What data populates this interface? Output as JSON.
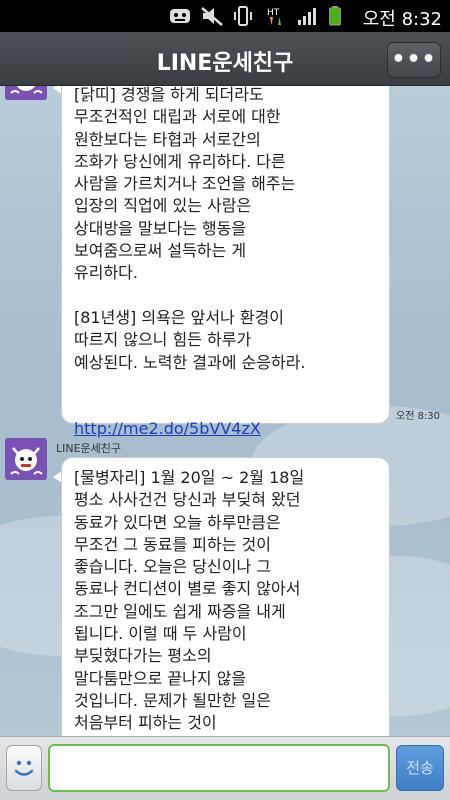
{
  "status_bar": {
    "time": "오전 8:32",
    "icons": [
      "gamepad-notification-icon",
      "mute-icon",
      "vibrate-icon",
      "data-transfer-icon",
      "signal-icon",
      "battery-icon"
    ],
    "battery_color": "#4caf1e"
  },
  "header": {
    "title": "LINE운세친구",
    "menu_label": "•••"
  },
  "messages": [
    {
      "sender": "",
      "text": "[닭띠] 경쟁을 하게 되더라도\n무조건적인 대립과 서로에 대한\n원한보다는 타협과 서로간의\n조화가 당신에게 유리하다. 다른\n사람을 가르치거나 조언을 해주는\n입장의 직업에 있는 사람은\n상대방을 말보다는 행동을\n보여줌으로써 설득하는 게\n유리하다.\n\n[81년생] 의욕은 앞서나 환경이\n따르지 않으니 힘든 하루가\n예상된다. 노력한 결과에 순응하라.",
      "link": "http://me2.do/5bVV4zX",
      "time": "오전 8:30"
    },
    {
      "sender": "LINE운세친구",
      "text": "[물병자리] 1월 20일 ~ 2월 18일\n평소 사사건건 당신과 부딪혀 왔던\n동료가 있다면 오늘 하루만큼은\n무조건 그 동료를 피하는 것이\n좋습니다. 오늘은 당신이나 그\n동료나 컨디션이 별로 좋지 않아서\n조그만 일에도 쉽게 짜증을 내게\n됩니다. 이럴 때 두 사람이\n부딪혔다가는 평소의\n말다툼만으로 끝나지 않을\n것입니다. 문제가 될만한 일은\n처음부터 피하는 것이"
    }
  ],
  "input_bar": {
    "emoji_icon": "smiley-icon",
    "input_value": "",
    "input_placeholder": "",
    "send_label": "전송",
    "accent_color": "#6cc04a",
    "send_color": "#4a8bd2"
  }
}
